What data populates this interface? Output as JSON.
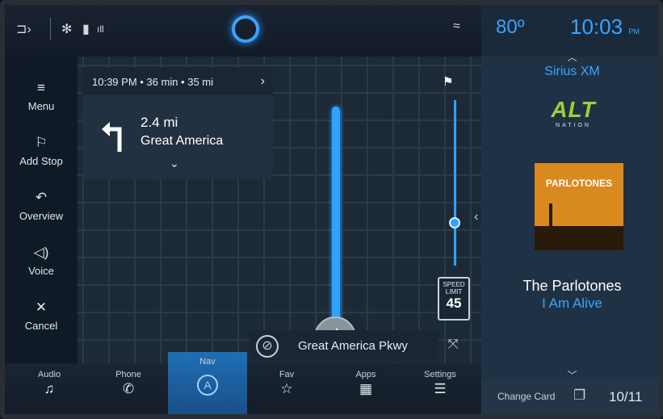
{
  "status": {
    "icons": [
      "phone-projection-icon",
      "settings-icon",
      "battery-icon",
      "signal-icon",
      "assistant-icon",
      "wifi-icon"
    ]
  },
  "header": {
    "temperature": "80º",
    "time": "10:03",
    "ampm": "PM"
  },
  "left_menu": {
    "items": [
      {
        "label": "Menu",
        "icon": "hamburger-icon"
      },
      {
        "label": "Add Stop",
        "icon": "add-stop-flag-icon"
      },
      {
        "label": "Overview",
        "icon": "overview-route-icon"
      },
      {
        "label": "Voice",
        "icon": "speaker-icon"
      },
      {
        "label": "Cancel",
        "icon": "close-icon"
      }
    ]
  },
  "navigation": {
    "eta_summary": "10:39 PM • 36 min • 35 mi",
    "next_turn_distance": "2.4 mi",
    "next_turn_street": "Great America",
    "current_road": "Great America Pkwy",
    "speed_limit_label": "SPEED LIMIT",
    "speed_limit_value": "45"
  },
  "media": {
    "source": "Sirius XM",
    "station_logo_text": "ALT",
    "station_logo_sub": "NATION",
    "album_art_text": "PARLOTONES",
    "artist": "The Parlotones",
    "song": "I Am Alive",
    "change_card_label": "Change Card",
    "card_page": "10/11"
  },
  "bottom_nav": {
    "tabs": [
      {
        "label": "Audio",
        "icon": "music-note-icon",
        "active": false
      },
      {
        "label": "Phone",
        "icon": "phone-icon",
        "active": false
      },
      {
        "label": "Nav",
        "icon": "nav-icon",
        "active": true
      },
      {
        "label": "Fav",
        "icon": "star-icon",
        "active": false
      },
      {
        "label": "Apps",
        "icon": "apps-grid-icon",
        "active": false
      },
      {
        "label": "Settings",
        "icon": "settings-sliders-icon",
        "active": false
      }
    ]
  },
  "colors": {
    "accent": "#3aa3ff",
    "route": "#2ea3ff",
    "station_logo": "#9bd13a"
  }
}
